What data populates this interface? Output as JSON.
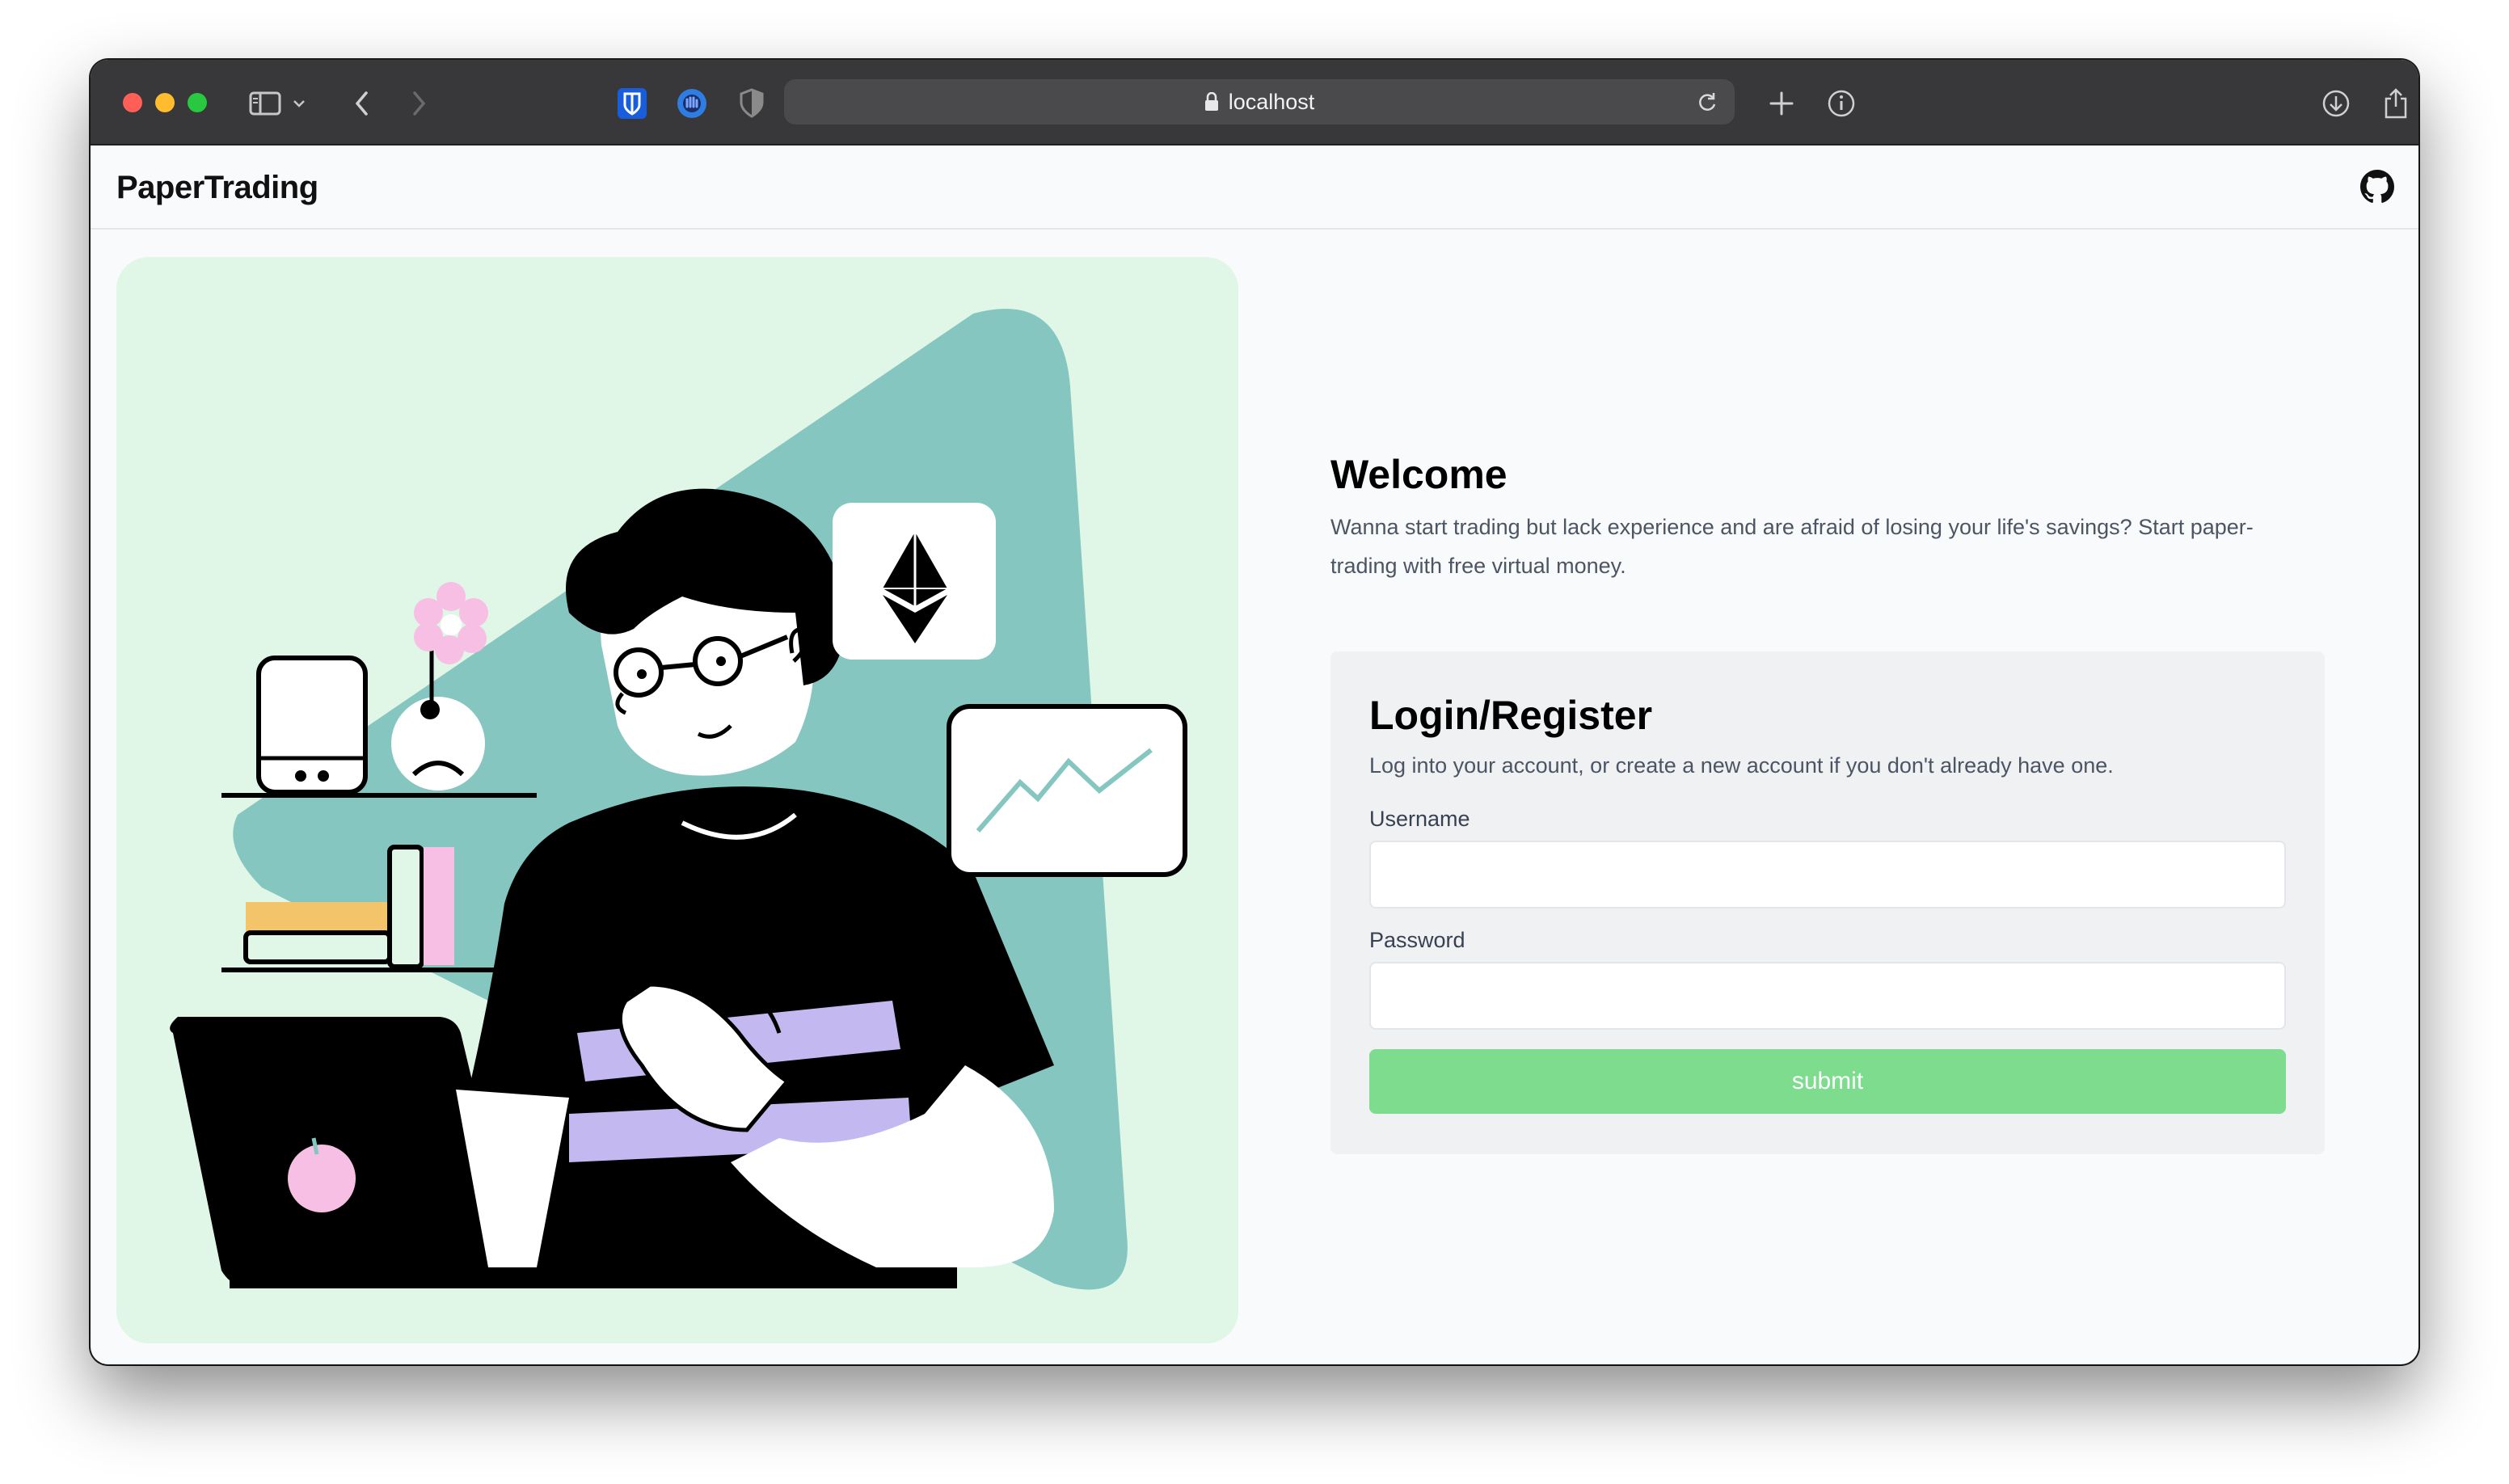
{
  "browser": {
    "url": "localhost"
  },
  "header": {
    "brand": "PaperTrading",
    "github_icon": "github-icon"
  },
  "welcome": {
    "title": "Welcome",
    "text": "Wanna start trading but lack experience and are afraid of losing your life's savings? Start paper-trading with free virtual money."
  },
  "login": {
    "title": "Login/Register",
    "subtitle": "Log into your account, or create a new account if you don't already have one.",
    "username_label": "Username",
    "username_value": "",
    "password_label": "Password",
    "password_value": "",
    "submit_label": "submit",
    "submit_color": "#7ddc8e"
  },
  "colors": {
    "illustration_bg": "#e0f6e7",
    "teal": "#86c6c1",
    "lavender": "#c4b8f0",
    "pink": "#f6bfe3",
    "orange": "#f4c46a"
  }
}
